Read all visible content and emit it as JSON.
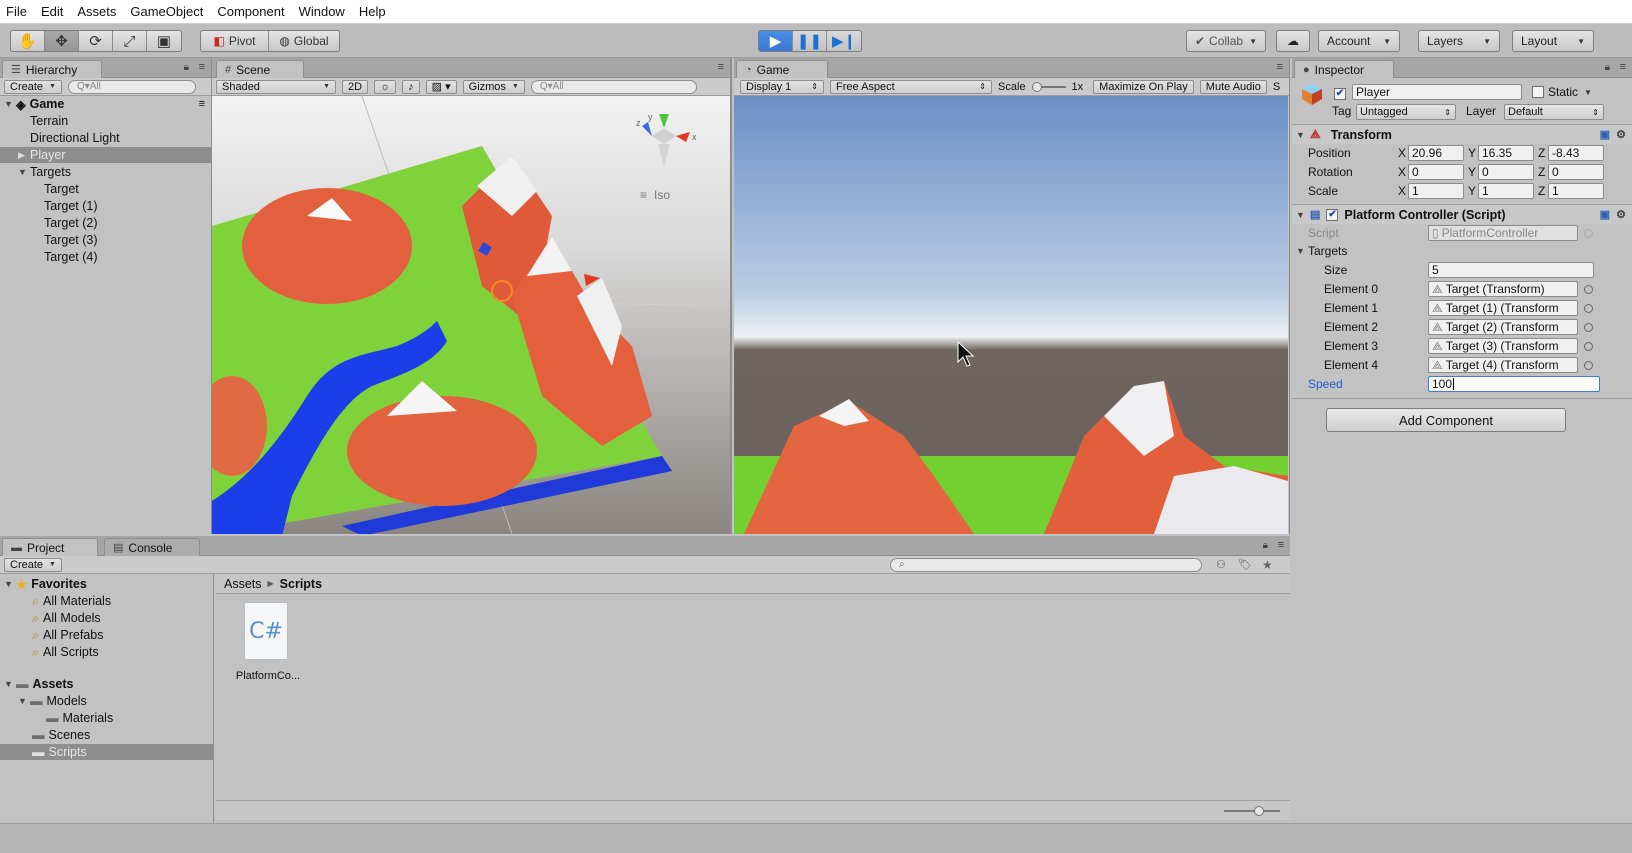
{
  "menu": [
    "File",
    "Edit",
    "Assets",
    "GameObject",
    "Component",
    "Window",
    "Help"
  ],
  "toolbar": {
    "pivot": "Pivot",
    "global": "Global",
    "collab": "Collab",
    "account": "Account",
    "layers": "Layers",
    "layout": "Layout"
  },
  "hierarchy": {
    "tab": "Hierarchy",
    "create": "Create",
    "search_placeholder": "Q▾All",
    "scene_name": "Game",
    "items": [
      "Terrain",
      "Directional Light",
      "Player",
      "Targets",
      "Target",
      "Target (1)",
      "Target (2)",
      "Target (3)",
      "Target (4)"
    ]
  },
  "scene": {
    "tab": "Scene",
    "shading": "Shaded",
    "mode2d": "2D",
    "gizmos": "Gizmos",
    "search_placeholder": "Q▾All",
    "projection": "Iso",
    "gizmo_axes": [
      "y",
      "x",
      "z"
    ]
  },
  "game": {
    "tab": "Game",
    "display": "Display 1",
    "aspect": "Free Aspect",
    "scale_label": "Scale",
    "scale_value": "1x",
    "maximize": "Maximize On Play",
    "mute": "Mute Audio",
    "stats": "S"
  },
  "inspector": {
    "tab": "Inspector",
    "object_name": "Player",
    "static_label": "Static",
    "tag_label": "Tag",
    "tag_value": "Untagged",
    "layer_label": "Layer",
    "layer_value": "Default",
    "transform": {
      "title": "Transform",
      "position_label": "Position",
      "rotation_label": "Rotation",
      "scale_label": "Scale",
      "axes": [
        "X",
        "Y",
        "Z"
      ],
      "position": [
        "20.96",
        "16.35",
        "-8.43"
      ],
      "rotation": [
        "0",
        "0",
        "0"
      ],
      "scale": [
        "1",
        "1",
        "1"
      ]
    },
    "script_component": {
      "title": "Platform Controller (Script)",
      "script_label": "Script",
      "script_value": "PlatformController",
      "targets_label": "Targets",
      "size_label": "Size",
      "size_value": "5",
      "elements": [
        {
          "label": "Element 0",
          "value": "Target (Transform)"
        },
        {
          "label": "Element 1",
          "value": "Target (1) (Transform"
        },
        {
          "label": "Element 2",
          "value": "Target (2) (Transform"
        },
        {
          "label": "Element 3",
          "value": "Target (3) (Transform"
        },
        {
          "label": "Element 4",
          "value": "Target (4) (Transform"
        }
      ],
      "speed_label": "Speed",
      "speed_value": "100"
    },
    "add_component": "Add Component"
  },
  "project": {
    "tab_project": "Project",
    "tab_console": "Console",
    "create": "Create",
    "favorites_label": "Favorites",
    "favorites": [
      "All Materials",
      "All Models",
      "All Prefabs",
      "All Scripts"
    ],
    "assets_label": "Assets",
    "folders": [
      "Models",
      "Materials",
      "Scenes",
      "Scripts"
    ],
    "breadcrumb": [
      "Assets",
      "Scripts"
    ],
    "file_name": "PlatformCo...",
    "file_glyph": "C#"
  }
}
